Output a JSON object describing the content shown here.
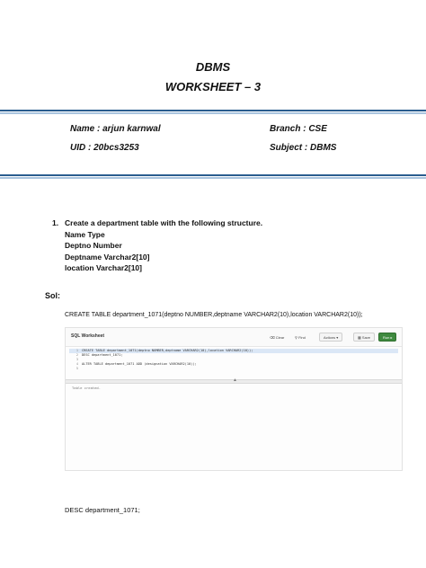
{
  "header": {
    "title": "DBMS",
    "subtitle": "WORKSHEET – 3"
  },
  "info": {
    "name": "Name : arjun karnwal",
    "uid": "UID : 20bcs3253",
    "branch": "Branch : CSE",
    "subject": "Subject : DBMS"
  },
  "question": {
    "number": "1.",
    "lines": [
      "Create a department table with the following structure.",
      "Name Type",
      "Deptno Number",
      "Deptname Varchar2[10]",
      "location Varchar2[10]"
    ]
  },
  "solution": {
    "label": "Sol:",
    "create_statement": "CREATE TABLE department_1071(deptno NUMBER,deptname VARCHAR2(10),location VARCHAR2(10));",
    "desc_statement": "DESC department_1071;"
  },
  "worksheet": {
    "title": "SQL Worksheet",
    "buttons": {
      "clear": "Clear",
      "find": "Find",
      "actions": "Actions",
      "save": "Save",
      "run": "Run"
    },
    "code_lines": [
      {
        "num": "1",
        "text": "CREATE TABLE department_1071(deptno NUMBER,deptname VARCHAR2(10),location VARCHAR2(10));"
      },
      {
        "num": "2",
        "text": "DESC department_1071;"
      },
      {
        "num": "3",
        "text": ""
      },
      {
        "num": "4",
        "text": "ALTER TABLE department_1071 ADD (designation VARCHAR2(10));"
      },
      {
        "num": "5",
        "text": ""
      }
    ],
    "result_text": "Table created."
  }
}
